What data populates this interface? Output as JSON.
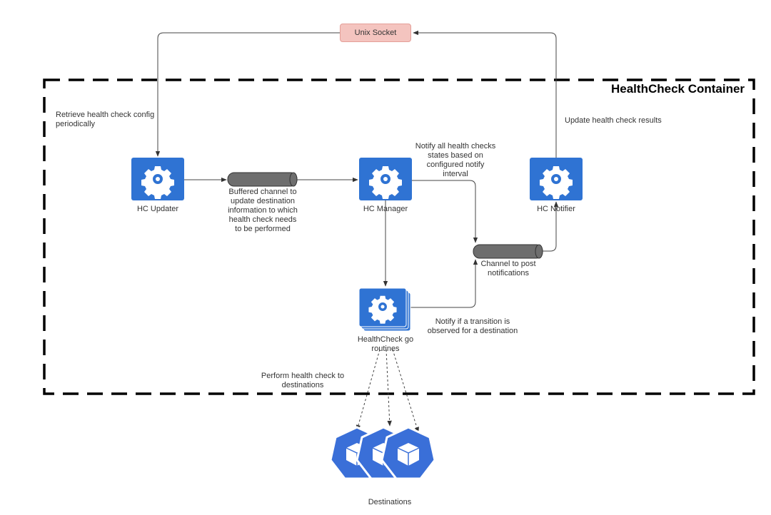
{
  "container": {
    "title": "HealthCheck Container"
  },
  "unix_socket": {
    "label": "Unix Socket"
  },
  "nodes": {
    "updater": "HC Updater",
    "manager": "HC Manager",
    "notifier": "HC Notifier",
    "goroutines": [
      "HealthCheck go",
      "routines"
    ],
    "destinations": "Destinations"
  },
  "annotations": {
    "retrieve": [
      "Retrieve health check config",
      "periodically"
    ],
    "update_results": "Update health check results",
    "buffered": [
      "Buffered channel to",
      "update destination",
      "information to which",
      "health check needs",
      "to be performed"
    ],
    "notify_all": [
      "Notify all health checks",
      "states based on",
      "configured notify",
      "interval"
    ],
    "channel_post": [
      "Channel to post",
      "notifications"
    ],
    "notify_transition": [
      "Notify if a transition is",
      "observed for a destination"
    ],
    "perform": [
      "Perform health check to",
      "destinations"
    ]
  },
  "colors": {
    "node": "#2f73d3",
    "socket_fill": "#f4c4bf",
    "pipe": "#6e6e6e",
    "line": "#444444"
  },
  "icons": {
    "node": "gear-icon",
    "destination": "cube-icon"
  }
}
